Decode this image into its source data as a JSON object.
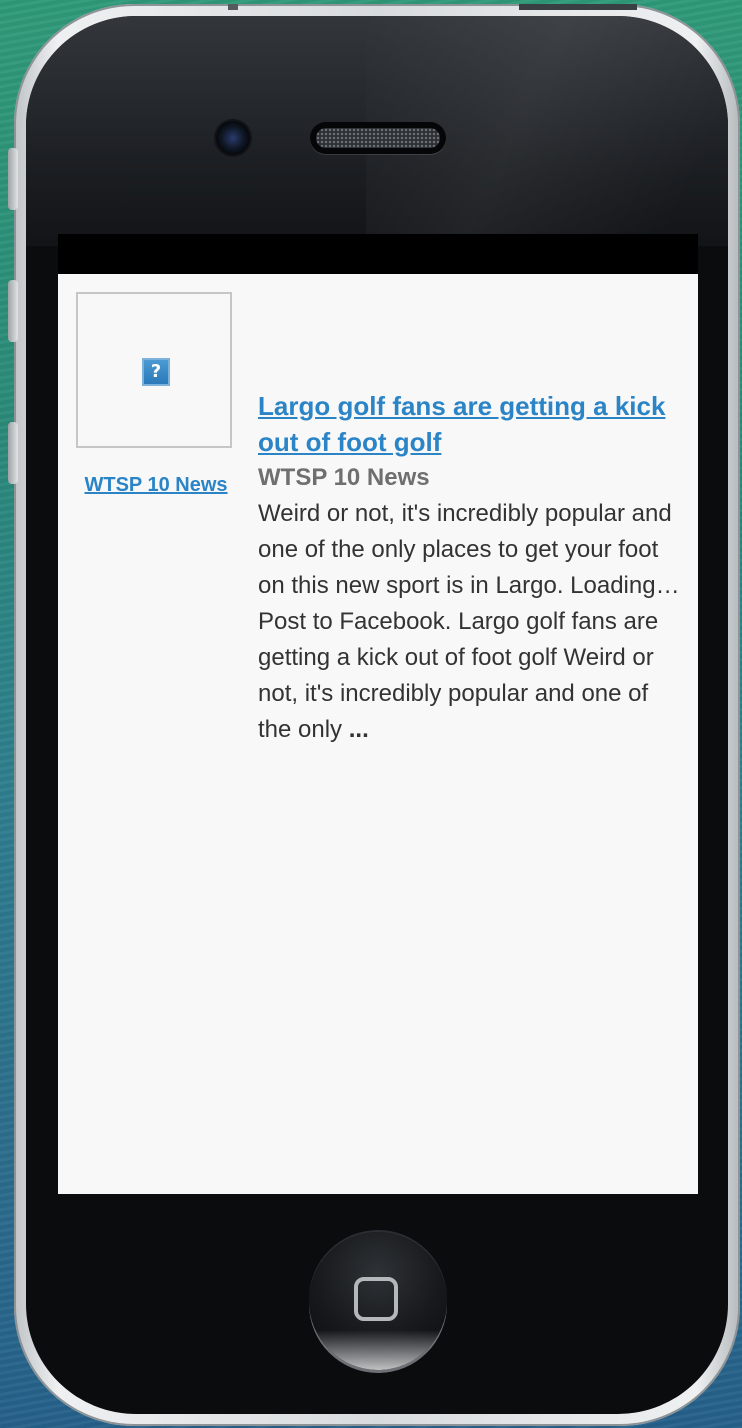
{
  "device": {
    "frame_color": "#d8dbdd",
    "bezel_color": "#0b0c0e"
  },
  "thumbnail": {
    "icon": "broken-image-icon",
    "glyph": "?"
  },
  "source_link": {
    "label": "WTSP 10 News"
  },
  "article": {
    "title": "Largo golf fans are getting a kick out of foot golf",
    "source": "WTSP 10 News",
    "snippet": "Weird or not, it's incredibly popular and one of the only places to get your foot on this new sport is in Largo. Loading… Post to Facebook. Largo golf fans are getting a kick out of foot golf Weird or not, it's incredibly popular and one of the only",
    "ellipsis": "...",
    "link_color": "#2a84c6"
  }
}
